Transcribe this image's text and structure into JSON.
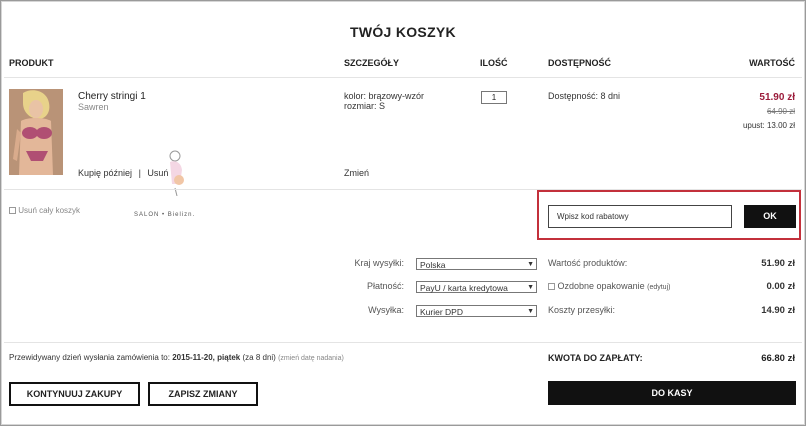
{
  "page": {
    "title": "TWÓJ KOSZYK"
  },
  "columns": {
    "product": "PRODUKT",
    "details": "SZCZEGÓŁY",
    "qty": "ILOŚĆ",
    "availability": "DOSTĘPNOŚĆ",
    "value": "WARTOŚĆ"
  },
  "item": {
    "name": "Cherry stringi 1",
    "brand": "Sawren",
    "color_label": "kolor:",
    "color_value": "brązowy-wzór",
    "size_label": "rozmiar:",
    "size_value": "S",
    "qty": "1",
    "availability": "Dostępność: 8 dni",
    "price": "51.90 zł",
    "old_price": "64.90 zł",
    "discount": "upust: 13.00 zł",
    "buy_later": "Kupię później",
    "separator": "|",
    "remove": "Usuń",
    "change": "Zmień"
  },
  "cart": {
    "remove_all": "Usuń cały koszyk"
  },
  "watermark": "SALON • Bielizn.",
  "coupon": {
    "placeholder": "Wpisz kod rabatowy",
    "ok": "OK"
  },
  "shipping": {
    "country_label": "Kraj wysyłki:",
    "country_value": "Polska",
    "payment_label": "Płatność:",
    "payment_value": "PayU / karta kredytowa",
    "method_label": "Wysyłka:",
    "method_value": "Kurier DPD"
  },
  "summary": {
    "products_label": "Wartość produktów:",
    "products_value": "51.90 zł",
    "gift_label": "Ozdobne opakowanie",
    "gift_edit": "(edytuj)",
    "gift_value": "0.00 zł",
    "delivery_label": "Koszty przesyłki:",
    "delivery_value": "14.90 zł",
    "total_label": "KWOTA DO ZAPŁATY:",
    "total_value": "66.80 zł"
  },
  "dispatch": {
    "prefix": "Przewidywany dzień wysłania zamówienia to:",
    "date": "2015-11-20, piątek",
    "days": "(za 8 dni)",
    "change": "(zmień datę nadania)"
  },
  "actions": {
    "continue": "KONTYNUUJ ZAKUPY",
    "save": "ZAPISZ ZMIANY",
    "checkout": "DO KASY"
  },
  "icons": {
    "arrow": "▼",
    "check": "☒"
  }
}
